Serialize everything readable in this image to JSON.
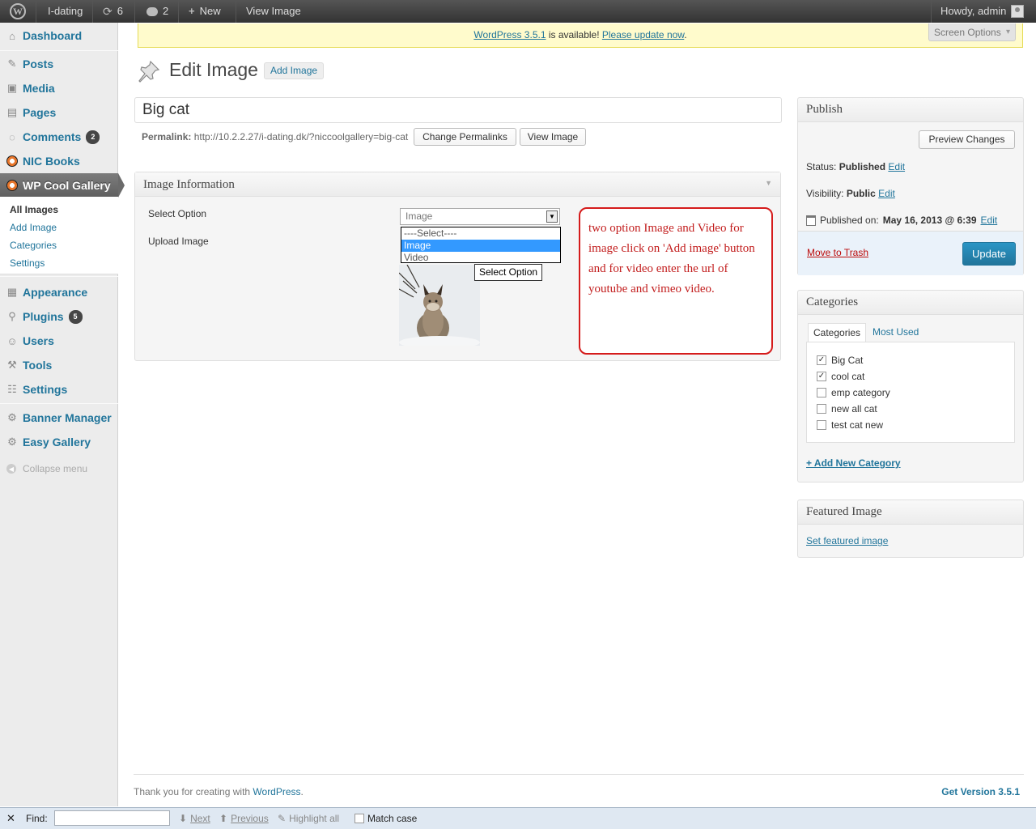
{
  "adminbar": {
    "site_name": "I-dating",
    "updates_count": "6",
    "comments_count": "2",
    "new_label": "New",
    "view_label": "View Image",
    "howdy": "Howdy, admin"
  },
  "notice": {
    "link1": "WordPress 3.5.1",
    "middle": " is available! ",
    "link2": "Please update now",
    "end": "."
  },
  "screen_options": "Screen Options",
  "sidebar": {
    "dashboard": "Dashboard",
    "posts": "Posts",
    "media": "Media",
    "pages": "Pages",
    "comments": "Comments",
    "comments_badge": "2",
    "nic_books": "NIC Books",
    "wp_cool_gallery": "WP Cool Gallery",
    "sub_all_images": "All Images",
    "sub_add_image": "Add Image",
    "sub_categories": "Categories",
    "sub_settings": "Settings",
    "appearance": "Appearance",
    "plugins": "Plugins",
    "plugins_badge": "5",
    "users": "Users",
    "tools": "Tools",
    "settings": "Settings",
    "banner_manager": "Banner Manager",
    "easy_gallery": "Easy Gallery",
    "collapse": "Collapse menu"
  },
  "page": {
    "title": "Edit Image",
    "add_new": "Add Image",
    "post_title": "Big cat",
    "permalink_label": "Permalink:",
    "permalink_url": "http://10.2.2.27/i-dating.dk/?niccoolgallery=big-cat",
    "change_permalinks": "Change Permalinks",
    "view_image": "View Image"
  },
  "image_info": {
    "heading": "Image Information",
    "select_option_label": "Select Option",
    "upload_image_label": "Upload Image",
    "select_value": "Image",
    "options": [
      "----Select----",
      "Image",
      "Video"
    ],
    "selected_option_index": 1,
    "select_option_button": "Select Option"
  },
  "annotation": "two option Image and Video for image click on 'Add image' button and for video enter the url of youtube and vimeo video.",
  "publish": {
    "heading": "Publish",
    "preview_changes": "Preview Changes",
    "status_label": "Status:",
    "status_value": "Published",
    "visibility_label": "Visibility:",
    "visibility_value": "Public",
    "published_on_label": "Published on:",
    "published_on_value": "May 16, 2013 @ 6:39",
    "edit": "Edit",
    "move_to_trash": "Move to Trash",
    "update": "Update"
  },
  "categories": {
    "heading": "Categories",
    "tab_all": "Categories",
    "tab_most_used": "Most Used",
    "items": [
      {
        "label": "Big Cat",
        "checked": true
      },
      {
        "label": "cool cat",
        "checked": true
      },
      {
        "label": "emp category",
        "checked": false
      },
      {
        "label": "new all cat",
        "checked": false
      },
      {
        "label": "test cat new",
        "checked": false
      }
    ],
    "add_new": "+ Add New Category"
  },
  "featured": {
    "heading": "Featured Image",
    "set_link": "Set featured image"
  },
  "footer": {
    "thanks_prefix": "Thank you for creating with ",
    "wordpress": "WordPress",
    "thanks_suffix": ".",
    "version": "Get Version 3.5.1"
  },
  "findbar": {
    "find_label": "Find:",
    "next": "Next",
    "previous": "Previous",
    "highlight_all": "Highlight all",
    "match_case": "Match case"
  },
  "colors": {
    "link": "#21759b",
    "annotation_red": "#d51b1b",
    "admin_bar": "#333333",
    "sidebar_bg": "#ececec"
  }
}
